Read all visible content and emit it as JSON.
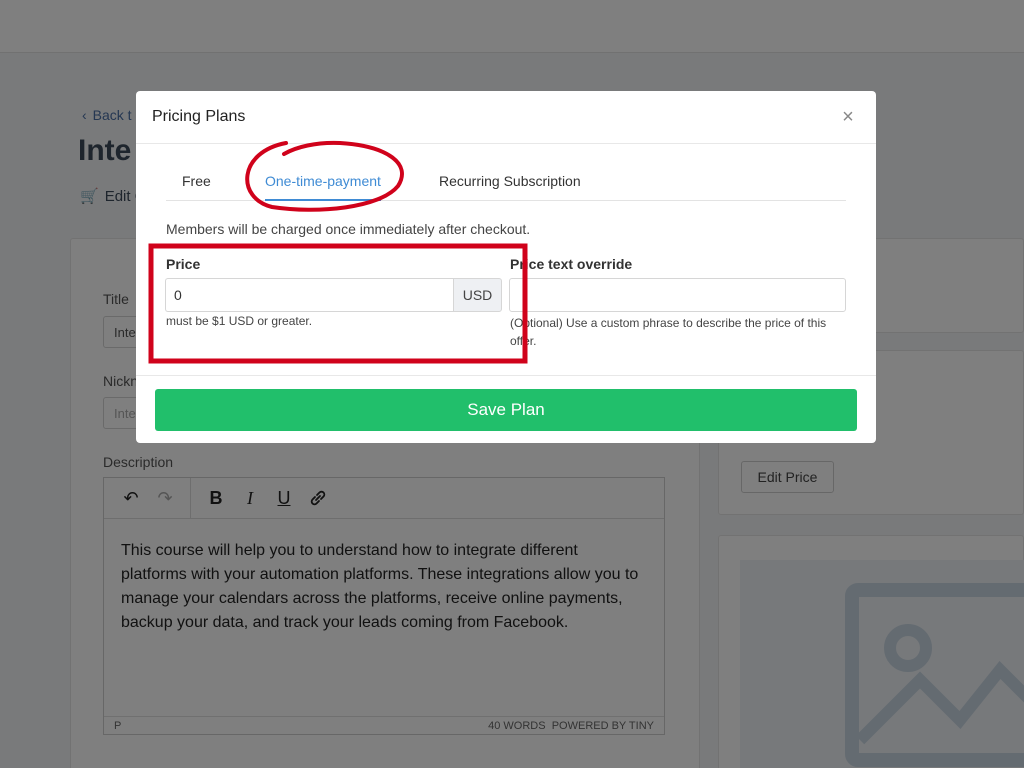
{
  "background": {
    "back_link": "Back t",
    "page_title": "Inte",
    "edit_link": "Edit C",
    "title_label": "Title",
    "title_value": "Inte",
    "nickname_label": "Nickn",
    "nickname_placeholder": "Inte",
    "description_label": "Description",
    "description_text": "This course will help you to understand how to integrate different platforms with your automation platforms. These integrations allow you to manage your calendars across the platforms, receive online payments, backup your data, and track your leads coming from Facebook.",
    "editor_path": "P",
    "editor_word_count": "40 WORDS",
    "editor_powered_by": "POWERED BY TINY",
    "edit_price_button": "Edit Price"
  },
  "modal": {
    "title": "Pricing Plans",
    "close_glyph": "×",
    "tabs": [
      {
        "label": "Free",
        "active": false
      },
      {
        "label": "One-time-payment",
        "active": true
      },
      {
        "label": "Recurring Subscription",
        "active": false
      }
    ],
    "description": "Members will be charged once immediately after checkout.",
    "price": {
      "label": "Price",
      "value": "0",
      "currency": "USD",
      "help": "must be $1 USD or greater."
    },
    "price_override": {
      "label": "Price text override",
      "value": "",
      "help": "(Optional) Use a custom phrase to describe the price of this offer."
    },
    "save_button": "Save Plan"
  },
  "colors": {
    "accent_blue": "#3f8bd4",
    "save_green": "#21bf6b",
    "annotation_red": "#d0021b"
  }
}
